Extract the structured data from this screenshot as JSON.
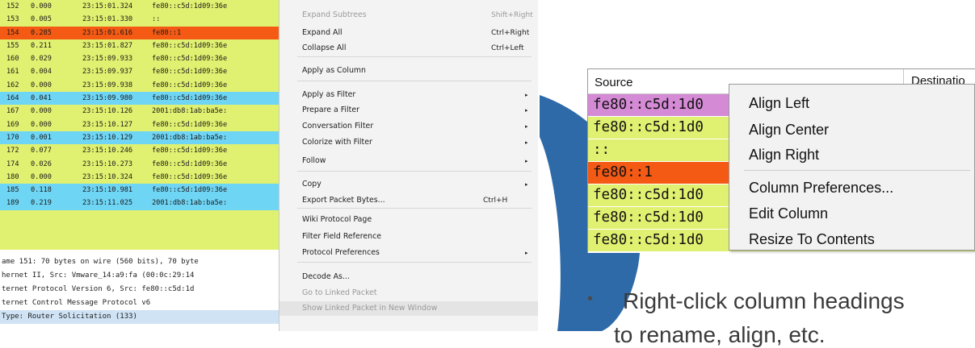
{
  "colors": {
    "row_yellow": "#e0f070",
    "row_blue": "#6fd5f5",
    "row_red": "#f45a14",
    "row_purple": "#d58ad6",
    "menu_bg": "#f3f3f3",
    "swoosh": "#2e6aa8"
  },
  "packet_rows": [
    {
      "no": "152",
      "delta": "0.000",
      "time": "23:15:01.324",
      "src": "fe80::c5d:1d09:36e",
      "color": "#e0f070"
    },
    {
      "no": "153",
      "delta": "0.005",
      "time": "23:15:01.330",
      "src": "::",
      "color": "#e0f070"
    },
    {
      "no": "154",
      "delta": "0.285",
      "time": "23:15:01.616",
      "src": "fe80::1",
      "color": "#f45a14"
    },
    {
      "no": "155",
      "delta": "0.211",
      "time": "23:15:01.827",
      "src": "fe80::c5d:1d09:36e",
      "color": "#e0f070"
    },
    {
      "no": "160",
      "delta": "0.029",
      "time": "23:15:09.933",
      "src": "fe80::c5d:1d09:36e",
      "color": "#e0f070"
    },
    {
      "no": "161",
      "delta": "0.004",
      "time": "23:15:09.937",
      "src": "fe80::c5d:1d09:36e",
      "color": "#e0f070"
    },
    {
      "no": "162",
      "delta": "0.000",
      "time": "23:15:09.938",
      "src": "fe80::c5d:1d09:36e",
      "color": "#e0f070"
    },
    {
      "no": "164",
      "delta": "0.041",
      "time": "23:15:09.980",
      "src": "fe80::c5d:1d09:36e",
      "color": "#6fd5f5"
    },
    {
      "no": "167",
      "delta": "0.000",
      "time": "23:15:10.126",
      "src": "2001:db8:1ab:ba5e:",
      "color": "#e0f070"
    },
    {
      "no": "169",
      "delta": "0.000",
      "time": "23:15:10.127",
      "src": "fe80::c5d:1d09:36e",
      "color": "#e0f070"
    },
    {
      "no": "170",
      "delta": "0.001",
      "time": "23:15:10.129",
      "src": "2001:db8:1ab:ba5e:",
      "color": "#6fd5f5"
    },
    {
      "no": "172",
      "delta": "0.077",
      "time": "23:15:10.246",
      "src": "fe80::c5d:1d09:36e",
      "color": "#e0f070"
    },
    {
      "no": "174",
      "delta": "0.026",
      "time": "23:15:10.273",
      "src": "fe80::c5d:1d09:36e",
      "color": "#e0f070"
    },
    {
      "no": "180",
      "delta": "0.000",
      "time": "23:15:10.324",
      "src": "fe80::c5d:1d09:36e",
      "color": "#e0f070"
    },
    {
      "no": "185",
      "delta": "0.118",
      "time": "23:15:10.981",
      "src": "fe80::c5d:1d09:36e",
      "color": "#6fd5f5"
    },
    {
      "no": "189",
      "delta": "0.219",
      "time": "23:15:11.025",
      "src": "2001:db8:1ab:ba5e:",
      "color": "#6fd5f5"
    },
    {
      "no": "",
      "delta": "",
      "time": "",
      "src": "",
      "color": "#e0f070"
    },
    {
      "no": "",
      "delta": "",
      "time": "",
      "src": "",
      "color": "#e0f070"
    },
    {
      "no": "",
      "delta": "",
      "time": "",
      "src": "",
      "color": "#e0f070"
    }
  ],
  "detail_rows": [
    "ame 151: 70 bytes on wire (560 bits), 70 byte",
    "hernet II, Src: Vmware_14:a9:fa (00:0c:29:14",
    "ternet Protocol Version 6, Src: fe80::c5d:1d",
    "ternet Control Message Protocol v6",
    "Type: Router Solicitation (133)"
  ],
  "menu1": [
    {
      "label": "Expand Subtrees",
      "shortcut": "Shift+Right",
      "submenu": false,
      "disabled": true
    },
    {
      "label": "Expand All",
      "shortcut": "Ctrl+Right",
      "submenu": false,
      "disabled": false
    },
    {
      "label": "Collapse All",
      "shortcut": "Ctrl+Left",
      "submenu": false,
      "disabled": false
    },
    {
      "label": "Apply as Column",
      "shortcut": "",
      "submenu": false,
      "disabled": false
    },
    {
      "label": "Apply as Filter",
      "shortcut": "",
      "submenu": true,
      "disabled": false
    },
    {
      "label": "Prepare a Filter",
      "shortcut": "",
      "submenu": true,
      "disabled": false
    },
    {
      "label": "Conversation Filter",
      "shortcut": "",
      "submenu": true,
      "disabled": false
    },
    {
      "label": "Colorize with Filter",
      "shortcut": "",
      "submenu": true,
      "disabled": false
    },
    {
      "label": "Follow",
      "shortcut": "",
      "submenu": true,
      "disabled": false
    },
    {
      "label": "Copy",
      "shortcut": "",
      "submenu": true,
      "disabled": false
    },
    {
      "label": "Export Packet Bytes...",
      "shortcut": "Ctrl+H",
      "submenu": false,
      "disabled": false
    },
    {
      "label": "Wiki Protocol Page",
      "shortcut": "",
      "submenu": false,
      "disabled": false
    },
    {
      "label": "Filter Field Reference",
      "shortcut": "",
      "submenu": false,
      "disabled": false
    },
    {
      "label": "Protocol Preferences",
      "shortcut": "",
      "submenu": true,
      "disabled": false
    },
    {
      "label": "Decode As...",
      "shortcut": "",
      "submenu": false,
      "disabled": false
    },
    {
      "label": "Go to Linked Packet",
      "shortcut": "",
      "submenu": false,
      "disabled": true
    },
    {
      "label": "Show Linked Packet in New Window",
      "shortcut": "",
      "submenu": false,
      "disabled": true
    }
  ],
  "column_panel": {
    "header_source": "Source",
    "header_destination": "Destinatio",
    "cells": [
      {
        "text": "fe80::c5d:1d0",
        "color": "#d58ad6"
      },
      {
        "text": "fe80::c5d:1d0",
        "color": "#e0f070"
      },
      {
        "text": "::",
        "color": "#e0f070"
      },
      {
        "text": "fe80::1",
        "color": "#f45a14"
      },
      {
        "text": "fe80::c5d:1d0",
        "color": "#e0f070"
      },
      {
        "text": "fe80::c5d:1d0",
        "color": "#e0f070"
      },
      {
        "text": "fe80::c5d:1d0",
        "color": "#e0f070"
      }
    ]
  },
  "menu2": [
    {
      "label": "Align Left"
    },
    {
      "label": "Align Center"
    },
    {
      "label": "Align Right"
    },
    {
      "label": "Column Preferences..."
    },
    {
      "label": "Edit Column"
    },
    {
      "label": "Resize To Contents"
    }
  ],
  "bullet": {
    "mark": "•",
    "line1": "Right-click column headings",
    "line2": "to rename, align, etc."
  }
}
